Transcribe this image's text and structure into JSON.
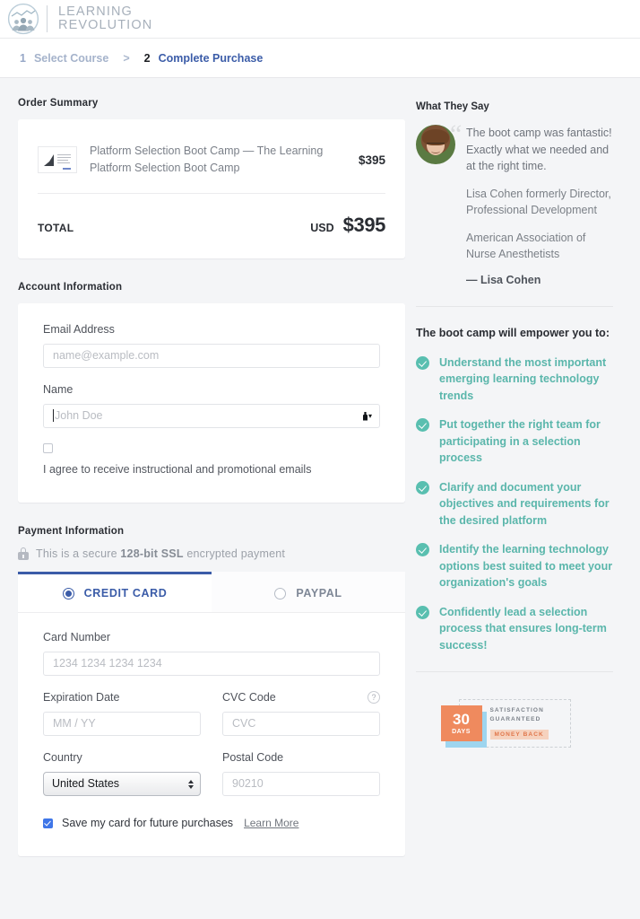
{
  "header": {
    "logo_line1": "LEARNING",
    "logo_line2": "REVOLUTION",
    "logo_icon": "learning-revolution-logo"
  },
  "breadcrumb": {
    "step1_num": "1",
    "step1_label": "Select Course",
    "separator": ">",
    "step2_num": "2",
    "step2_label": "Complete Purchase"
  },
  "order": {
    "section_title": "Order Summary",
    "item_name": "Platform Selection Boot Camp — The Learning Platform Selection Boot Camp",
    "item_price": "$395",
    "total_label": "TOTAL",
    "currency": "USD",
    "total_amount": "$395"
  },
  "account": {
    "section_title": "Account Information",
    "email_label": "Email Address",
    "email_placeholder": "name@example.com",
    "email_value": "",
    "name_label": "Name",
    "name_placeholder": "John Doe",
    "name_value": "",
    "consent_text": "I agree to receive instructional and promotional emails",
    "consent_checked": false
  },
  "payment": {
    "section_title": "Payment Information",
    "secure_prefix": "This is a secure ",
    "secure_bold": "128-bit SSL",
    "secure_suffix": " encrypted payment",
    "tab_credit_card": "CREDIT CARD",
    "tab_paypal": "PAYPAL",
    "active_tab": "CREDIT CARD",
    "card_number_label": "Card Number",
    "card_number_placeholder": "1234 1234 1234 1234",
    "expiration_label": "Expiration Date",
    "expiration_placeholder": "MM / YY",
    "cvc_label": "CVC Code",
    "cvc_placeholder": "CVC",
    "cvc_help": "?",
    "country_label": "Country",
    "country_value": "United States",
    "postal_label": "Postal Code",
    "postal_placeholder": "90210",
    "save_card_text": "Save my card for future purchases",
    "save_card_checked": true,
    "learn_more": "Learn More"
  },
  "testimonial": {
    "title": "What They Say",
    "quote": "The boot camp was fantastic! Exactly what we needed and at the right time.",
    "meta_1": "Lisa Cohen formerly Director, Professional Development",
    "meta_2": "American Association of Nurse Anesthetists",
    "attribution": "— Lisa Cohen"
  },
  "benefits": {
    "title": "The boot camp will empower you to:",
    "items": [
      "Understand the most important emerging learning technology trends",
      "Put together the right team for participating in a selection process",
      "Clarify and document your objectives and requirements for the desired platform",
      "Identify the learning technology options best suited to meet your organization's goals",
      "Confidently lead a selection process that ensures long-term success!"
    ]
  },
  "guarantee": {
    "days_number": "30",
    "days_label": "DAYS",
    "line1": "SATISFACTION",
    "line2": "GUARANTEED",
    "money_back": "MONEY BACK"
  },
  "colors": {
    "accent_blue": "#3b5ca8",
    "teal": "#59bfb0",
    "orange": "#ef8a5e",
    "page_bg": "#f4f5f7"
  }
}
